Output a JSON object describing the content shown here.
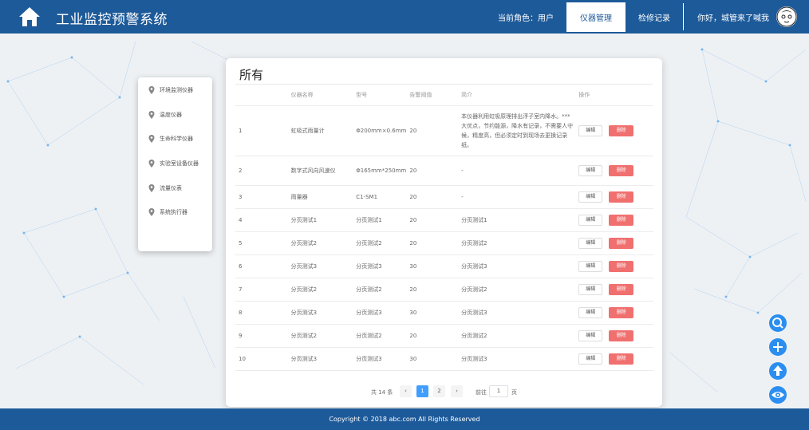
{
  "header": {
    "app_title": "工业监控预警系统",
    "role_label": "当前角色：用户",
    "nav": [
      {
        "label": "仪器管理",
        "active": true
      },
      {
        "label": "检修记录",
        "active": false
      }
    ],
    "greeting": "你好，城管来了喊我"
  },
  "sidebar": {
    "items": [
      {
        "label": "环境监测仪器",
        "icon": "map-pin-icon"
      },
      {
        "label": "温度仪器",
        "icon": "map-pin-icon"
      },
      {
        "label": "生命科学仪器",
        "icon": "map-pin-icon"
      },
      {
        "label": "实验室设备仪器",
        "icon": "map-pin-icon"
      },
      {
        "label": "流量仪表",
        "icon": "map-pin-icon"
      },
      {
        "label": "系统执行器",
        "icon": "map-pin-icon"
      }
    ]
  },
  "panel": {
    "title": "所有",
    "columns": [
      "",
      "仪器名称",
      "型号",
      "告警阈值",
      "简介",
      "操作"
    ],
    "edit_label": "编辑",
    "delete_label": "删除",
    "rows": [
      {
        "id": "1",
        "name": "虹吸式雨量计",
        "model": "Φ200mm×0.6mm",
        "threshold": "20",
        "desc": "本仪器利用虹吸原理排出浮子室内降水。***大优点，节约能源，降水有记录，不需要人守候，精度高，但必须定时到现场去更换记录纸。"
      },
      {
        "id": "2",
        "name": "数字式风向风速仪",
        "model": "Φ165mm*250mm",
        "threshold": "20",
        "desc": "-"
      },
      {
        "id": "3",
        "name": "雨量器",
        "model": "C1-SM1",
        "threshold": "20",
        "desc": "-"
      },
      {
        "id": "4",
        "name": "分页测试1",
        "model": "分页测试1",
        "threshold": "20",
        "desc": "分页测试1"
      },
      {
        "id": "5",
        "name": "分页测试2",
        "model": "分页测试2",
        "threshold": "20",
        "desc": "分页测试2"
      },
      {
        "id": "6",
        "name": "分页测试3",
        "model": "分页测试3",
        "threshold": "30",
        "desc": "分页测试3"
      },
      {
        "id": "7",
        "name": "分页测试2",
        "model": "分页测试2",
        "threshold": "20",
        "desc": "分页测试2"
      },
      {
        "id": "8",
        "name": "分页测试3",
        "model": "分页测试3",
        "threshold": "30",
        "desc": "分页测试3"
      },
      {
        "id": "9",
        "name": "分页测试2",
        "model": "分页测试2",
        "threshold": "20",
        "desc": "分页测试2"
      },
      {
        "id": "10",
        "name": "分页测试3",
        "model": "分页测试3",
        "threshold": "30",
        "desc": "分页测试3"
      }
    ]
  },
  "pagination": {
    "total_label": "共 14 条",
    "prev": "‹",
    "next": "›",
    "pages": [
      "1",
      "2"
    ],
    "current": "1",
    "goto_label": "前往",
    "goto_value": "1",
    "page_suffix": "页"
  },
  "footer": {
    "copyright": "Copyright © 2018 abc.com All Rights Reserved"
  },
  "fab": [
    {
      "icon": "search-icon"
    },
    {
      "icon": "plus-icon"
    },
    {
      "icon": "arrow-up-icon"
    },
    {
      "icon": "eye-icon"
    }
  ],
  "colors": {
    "header": "#1d5a99",
    "primary": "#409eff",
    "danger": "#f0706f",
    "fab": "#2b8ef0"
  }
}
